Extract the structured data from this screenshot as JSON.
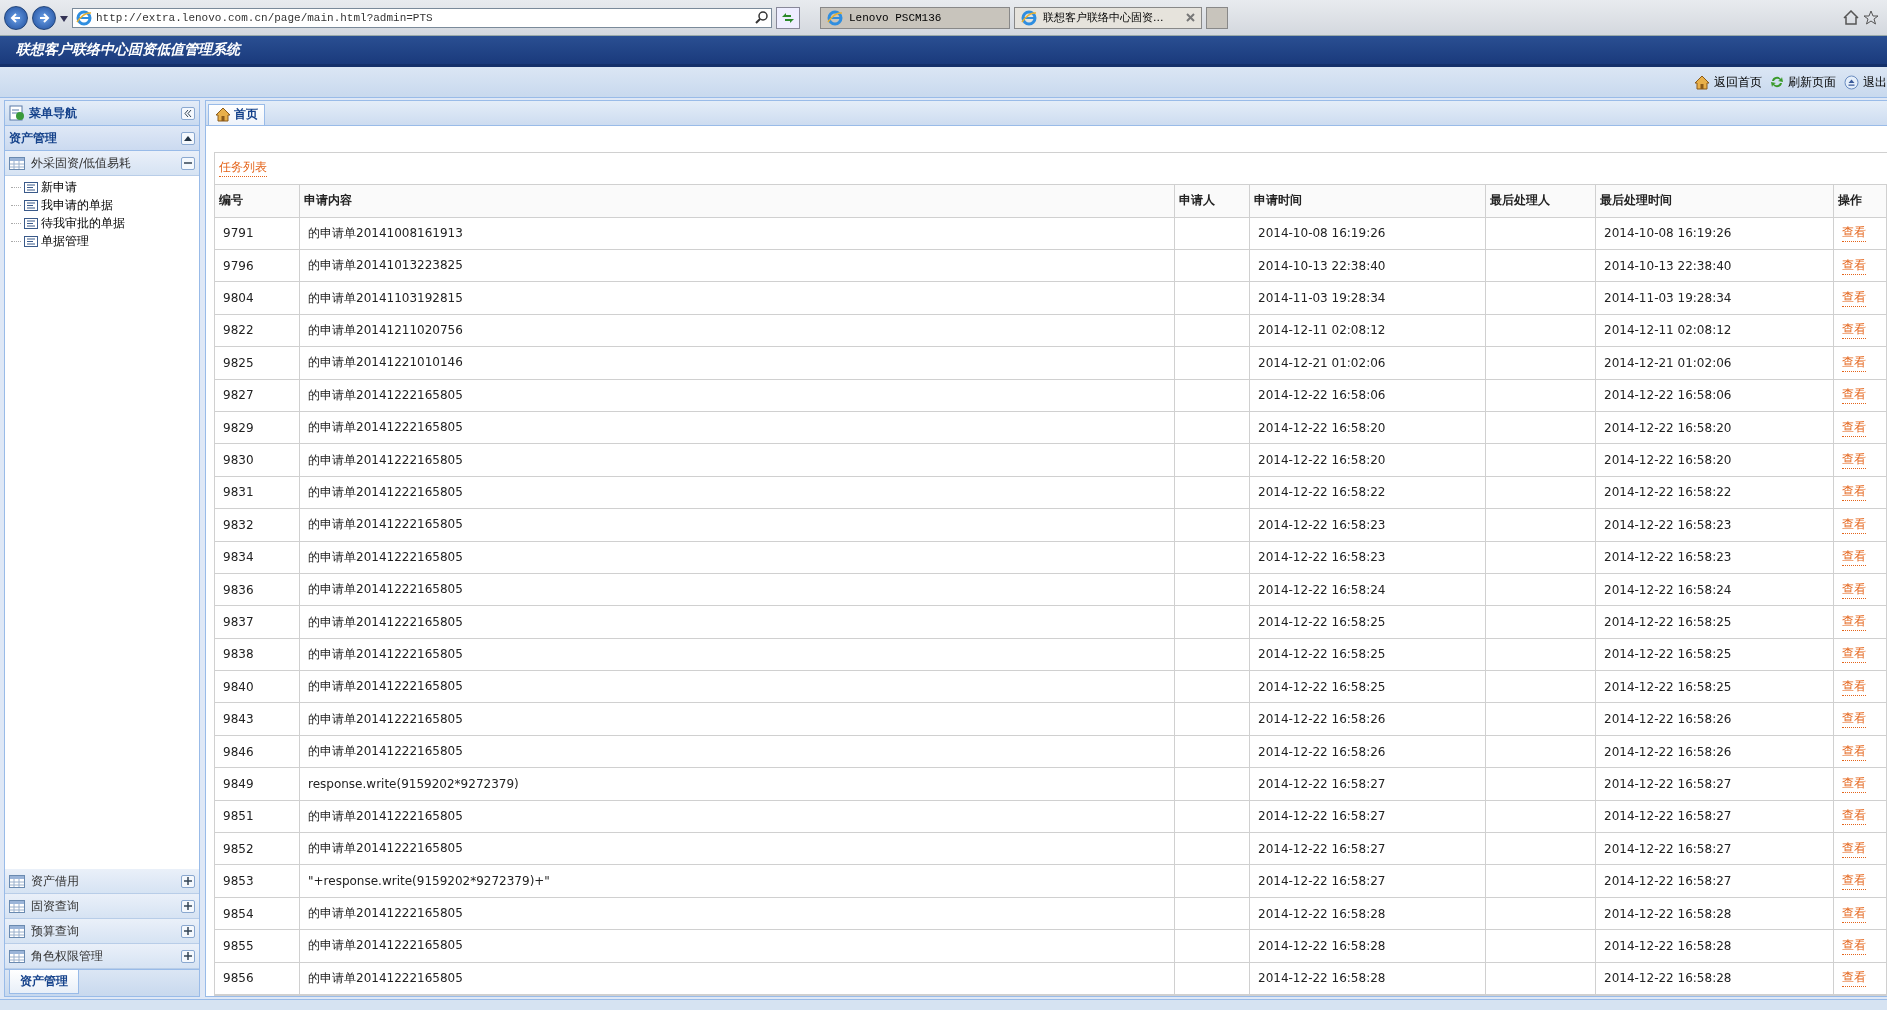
{
  "browser": {
    "address": "http://extra.lenovo.com.cn/page/main.html?admin=PTS",
    "tabs": [
      {
        "label": "Lenovo PSCM136",
        "selected": false
      },
      {
        "label": "联想客户联络中心固资...",
        "selected": true
      }
    ]
  },
  "app_title": "联想客户联络中心固资低值管理系统",
  "top_links": [
    {
      "kind": "home",
      "label": "返回首页"
    },
    {
      "kind": "refresh",
      "label": "刷新页面"
    },
    {
      "kind": "logout",
      "label": "退出"
    }
  ],
  "sidebar": {
    "title": "菜单导航",
    "section": "资产管理",
    "groups": [
      {
        "label": "外采固资/低值易耗",
        "expanded": true,
        "children": [
          {
            "label": "新申请"
          },
          {
            "label": "我申请的单据"
          },
          {
            "label": "待我审批的单据"
          },
          {
            "label": "单据管理"
          }
        ]
      },
      {
        "label": "资产借用",
        "expanded": false
      },
      {
        "label": "固资查询",
        "expanded": false
      },
      {
        "label": "预算查询",
        "expanded": false
      },
      {
        "label": "角色权限管理",
        "expanded": false
      }
    ],
    "bottom_tab": "资产管理"
  },
  "content_tabs": [
    {
      "label": "首页",
      "selected": true
    }
  ],
  "task_list": {
    "title": "任务列表",
    "columns": [
      "编号",
      "申请内容",
      "申请人",
      "申请时间",
      "最后处理人",
      "最后处理时间",
      "操作"
    ],
    "rows": [
      {
        "id": "9791",
        "content": "的申请单20141008161913",
        "time": "2014-10-08 16:19:26",
        "last_time": "2014-10-08 16:19:26",
        "action": "查看"
      },
      {
        "id": "9796",
        "content": "的申请单20141013223825",
        "time": "2014-10-13 22:38:40",
        "last_time": "2014-10-13 22:38:40",
        "action": "查看"
      },
      {
        "id": "9804",
        "content": "的申请单20141103192815",
        "time": "2014-11-03 19:28:34",
        "last_time": "2014-11-03 19:28:34",
        "action": "查看"
      },
      {
        "id": "9822",
        "content": "的申请单20141211020756",
        "time": "2014-12-11 02:08:12",
        "last_time": "2014-12-11 02:08:12",
        "action": "查看"
      },
      {
        "id": "9825",
        "content": "的申请单20141221010146",
        "time": "2014-12-21 01:02:06",
        "last_time": "2014-12-21 01:02:06",
        "action": "查看"
      },
      {
        "id": "9827",
        "content": "的申请单20141222165805",
        "time": "2014-12-22 16:58:06",
        "last_time": "2014-12-22 16:58:06",
        "action": "查看"
      },
      {
        "id": "9829",
        "content": "的申请单20141222165805",
        "time": "2014-12-22 16:58:20",
        "last_time": "2014-12-22 16:58:20",
        "action": "查看"
      },
      {
        "id": "9830",
        "content": "的申请单20141222165805",
        "time": "2014-12-22 16:58:20",
        "last_time": "2014-12-22 16:58:20",
        "action": "查看"
      },
      {
        "id": "9831",
        "content": "的申请单20141222165805",
        "time": "2014-12-22 16:58:22",
        "last_time": "2014-12-22 16:58:22",
        "action": "查看"
      },
      {
        "id": "9832",
        "content": "的申请单20141222165805",
        "time": "2014-12-22 16:58:23",
        "last_time": "2014-12-22 16:58:23",
        "action": "查看"
      },
      {
        "id": "9834",
        "content": "的申请单20141222165805",
        "time": "2014-12-22 16:58:23",
        "last_time": "2014-12-22 16:58:23",
        "action": "查看"
      },
      {
        "id": "9836",
        "content": "的申请单20141222165805",
        "time": "2014-12-22 16:58:24",
        "last_time": "2014-12-22 16:58:24",
        "action": "查看"
      },
      {
        "id": "9837",
        "content": "的申请单20141222165805",
        "time": "2014-12-22 16:58:25",
        "last_time": "2014-12-22 16:58:25",
        "action": "查看"
      },
      {
        "id": "9838",
        "content": "的申请单20141222165805",
        "time": "2014-12-22 16:58:25",
        "last_time": "2014-12-22 16:58:25",
        "action": "查看"
      },
      {
        "id": "9840",
        "content": "的申请单20141222165805",
        "time": "2014-12-22 16:58:25",
        "last_time": "2014-12-22 16:58:25",
        "action": "查看"
      },
      {
        "id": "9843",
        "content": "的申请单20141222165805",
        "time": "2014-12-22 16:58:26",
        "last_time": "2014-12-22 16:58:26",
        "action": "查看"
      },
      {
        "id": "9846",
        "content": "的申请单20141222165805",
        "time": "2014-12-22 16:58:26",
        "last_time": "2014-12-22 16:58:26",
        "action": "查看"
      },
      {
        "id": "9849",
        "content": "response.write(9159202*9272379)",
        "time": "2014-12-22 16:58:27",
        "last_time": "2014-12-22 16:58:27",
        "action": "查看"
      },
      {
        "id": "9851",
        "content": "的申请单20141222165805",
        "time": "2014-12-22 16:58:27",
        "last_time": "2014-12-22 16:58:27",
        "action": "查看"
      },
      {
        "id": "9852",
        "content": "的申请单20141222165805",
        "time": "2014-12-22 16:58:27",
        "last_time": "2014-12-22 16:58:27",
        "action": "查看"
      },
      {
        "id": "9853",
        "content": "\"+response.write(9159202*9272379)+\"",
        "time": "2014-12-22 16:58:27",
        "last_time": "2014-12-22 16:58:27",
        "action": "查看"
      },
      {
        "id": "9854",
        "content": "的申请单20141222165805",
        "time": "2014-12-22 16:58:28",
        "last_time": "2014-12-22 16:58:28",
        "action": "查看"
      },
      {
        "id": "9855",
        "content": "的申请单20141222165805",
        "time": "2014-12-22 16:58:28",
        "last_time": "2014-12-22 16:58:28",
        "action": "查看"
      },
      {
        "id": "9856",
        "content": "的申请单20141222165805",
        "time": "2014-12-22 16:58:28",
        "last_time": "2014-12-22 16:58:28",
        "action": "查看"
      }
    ]
  }
}
